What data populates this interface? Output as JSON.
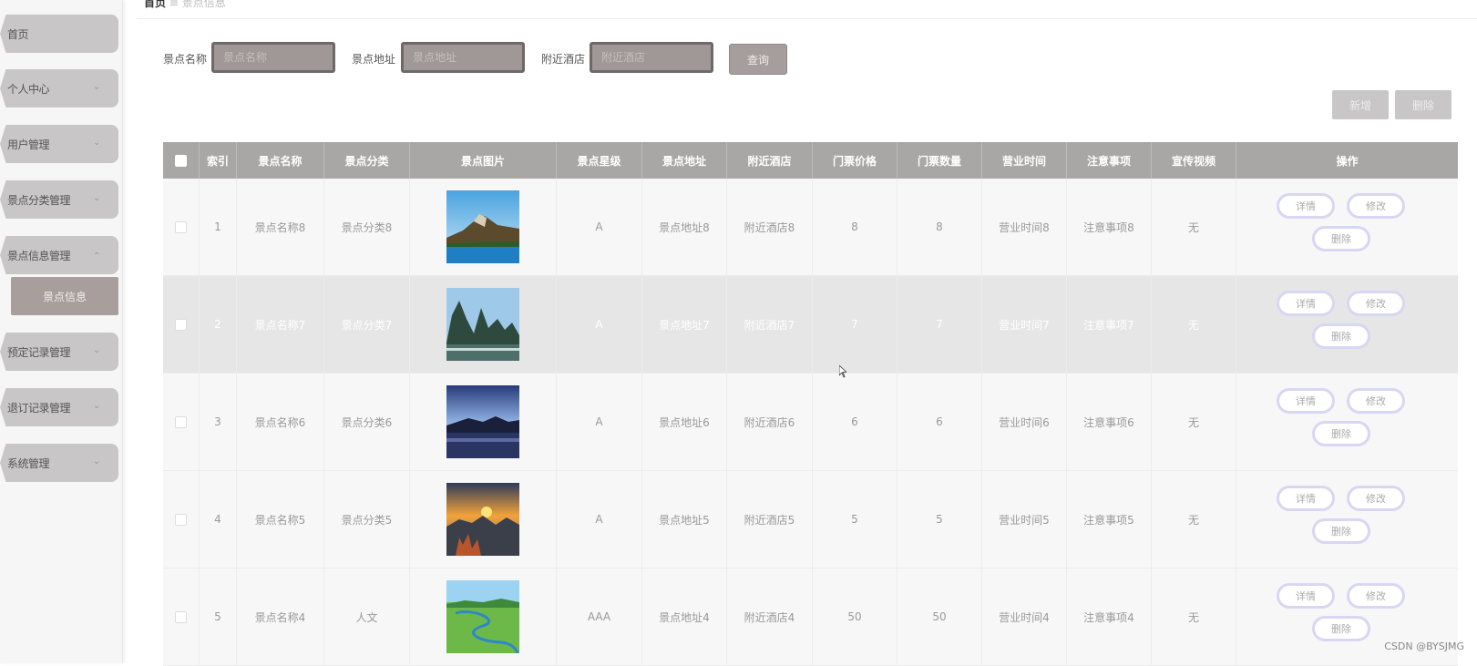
{
  "sidebar": {
    "items": [
      {
        "label": "首页",
        "expanded": null
      },
      {
        "label": "个人中心",
        "expanded": false
      },
      {
        "label": "用户管理",
        "expanded": false
      },
      {
        "label": "景点分类管理",
        "expanded": false
      },
      {
        "label": "景点信息管理",
        "expanded": true
      },
      {
        "label": "预定记录管理",
        "expanded": false
      },
      {
        "label": "退订记录管理",
        "expanded": false
      },
      {
        "label": "系统管理",
        "expanded": false
      }
    ],
    "sub_item": "景点信息"
  },
  "breadcrumb": {
    "home": "首页",
    "separator": "≡",
    "current": "景点信息"
  },
  "search": {
    "name_label": "景点名称",
    "name_placeholder": "景点名称",
    "addr_label": "景点地址",
    "addr_placeholder": "景点地址",
    "hotel_label": "附近酒店",
    "hotel_placeholder": "附近酒店",
    "query_button": "查询"
  },
  "toolbar": {
    "add_button": "新增",
    "delete_button": "删除"
  },
  "table": {
    "headers": [
      "索引",
      "景点名称",
      "景点分类",
      "景点图片",
      "景点星级",
      "景点地址",
      "附近酒店",
      "门票价格",
      "门票数量",
      "营业时间",
      "注意事项",
      "宣传视频",
      "操作"
    ],
    "rows": [
      {
        "index": "1",
        "name": "景点名称8",
        "category": "景点分类8",
        "image": "landscape-lake-hill",
        "star": "A",
        "address": "景点地址8",
        "hotel": "附近酒店8",
        "price": "8",
        "qty": "8",
        "hours": "营业时间8",
        "notes": "注意事项8",
        "video": "无"
      },
      {
        "index": "2",
        "name": "景点名称7",
        "category": "景点分类7",
        "image": "landscape-karst-river",
        "star": "A",
        "address": "景点地址7",
        "hotel": "附近酒店7",
        "price": "7",
        "qty": "7",
        "hours": "营业时间7",
        "notes": "注意事项7",
        "video": "无"
      },
      {
        "index": "3",
        "name": "景点名称6",
        "category": "景点分类6",
        "image": "landscape-dusk-lake",
        "star": "A",
        "address": "景点地址6",
        "hotel": "附近酒店6",
        "price": "6",
        "qty": "6",
        "hours": "营业时间6",
        "notes": "注意事项6",
        "video": "无"
      },
      {
        "index": "4",
        "name": "景点名称5",
        "category": "景点分类5",
        "image": "landscape-sunset-mountain",
        "star": "A",
        "address": "景点地址5",
        "hotel": "附近酒店5",
        "price": "5",
        "qty": "5",
        "hours": "营业时间5",
        "notes": "注意事项5",
        "video": "无"
      },
      {
        "index": "5",
        "name": "景点名称4",
        "category": "人文",
        "image": "landscape-grassland-river",
        "star": "AAA",
        "address": "景点地址4",
        "hotel": "附近酒店4",
        "price": "50",
        "qty": "50",
        "hours": "营业时间4",
        "notes": "注意事项4",
        "video": "无"
      }
    ],
    "row_actions": {
      "detail": "详情",
      "edit": "修改",
      "delete": "删除"
    }
  },
  "watermark": "CSDN @BYSJMG",
  "colors": {
    "header_bg": "#a9a7a6",
    "menu_bg": "#c8c6c6",
    "input_bg": "#a09896",
    "action_border": "#d8d6f2"
  }
}
